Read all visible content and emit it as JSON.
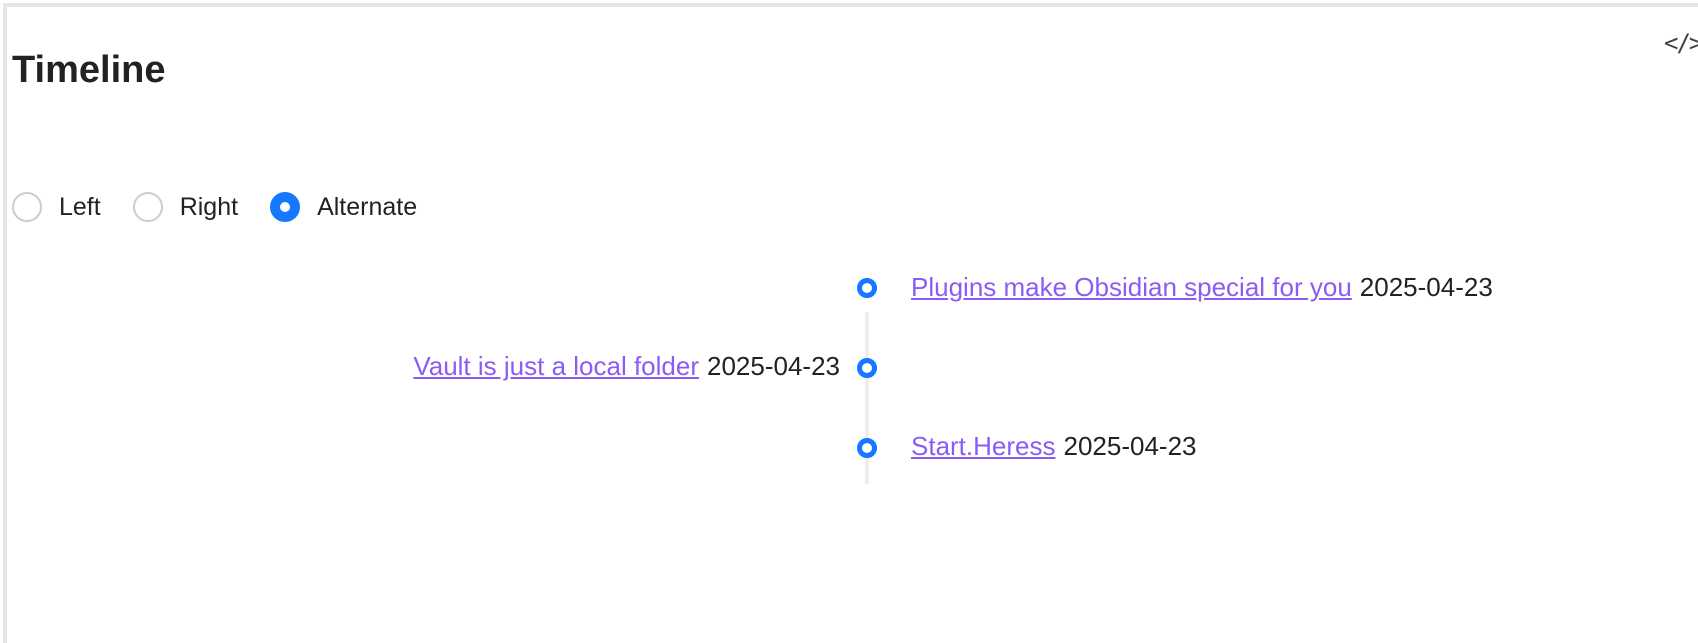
{
  "title": "Timeline",
  "code_toggle_icon": "code-icon",
  "code_toggle_glyph": "</>",
  "modes": [
    {
      "label": "Left",
      "checked": false
    },
    {
      "label": "Right",
      "checked": false
    },
    {
      "label": "Alternate",
      "checked": true
    }
  ],
  "accent_color": "#1677ff",
  "link_color": "#8a5cf5",
  "timeline": {
    "items": [
      {
        "link": "Plugins make Obsidian special for you",
        "date": "2025-04-23",
        "side": "right"
      },
      {
        "link": "Vault is just a local folder",
        "date": "2025-04-23",
        "side": "left"
      },
      {
        "link": "Start.Heress",
        "date": "2025-04-23",
        "side": "right"
      }
    ]
  }
}
